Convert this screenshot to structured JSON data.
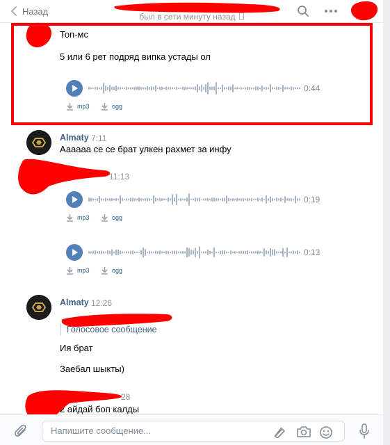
{
  "header": {
    "back_label": "Назад",
    "status_text": "был в сети минуту назад"
  },
  "messages": [
    {
      "title": "Топ-мс",
      "text": "5 или 6 рет подряд випка устады ол",
      "audio": {
        "duration": "0:44",
        "mp3_label": "mp3",
        "ogg_label": "ogg"
      }
    },
    {
      "author": "Almaty",
      "time": "7:11",
      "text": "Аааааа се се брат улкен рахмет за инфу"
    },
    {
      "time": "11:13",
      "audios": [
        {
          "duration": "0:19",
          "mp3_label": "mp3",
          "ogg_label": "ogg"
        },
        {
          "duration": "0:13",
          "mp3_label": "mp3",
          "ogg_label": "ogg"
        }
      ]
    },
    {
      "author": "Almaty",
      "time": "12:26",
      "quote": "Голосовое сообщение",
      "lines": [
        "Ия брат",
        "Заебал шыкты)"
      ]
    },
    {
      "time_partial": "28",
      "text": "2 айдай боп калды"
    }
  ],
  "composer": {
    "placeholder": "Напишите сообщение..."
  },
  "colors": {
    "accent": "#5181b8",
    "author": "#42648b",
    "link": "#2a5885",
    "redaction": "#ff0000"
  },
  "icons": [
    "chevron-left-icon",
    "phone-icon",
    "search-icon",
    "more-icon",
    "play-icon",
    "download-icon",
    "paperclip-icon",
    "pen-icon",
    "camera-icon",
    "smile-icon",
    "microphone-icon"
  ]
}
